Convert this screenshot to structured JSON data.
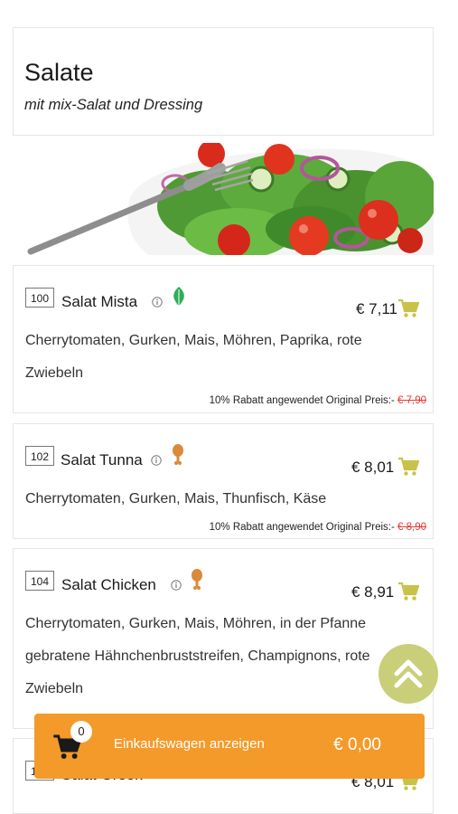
{
  "category": {
    "title": "Salate",
    "subtitle": "mit mix-Salat und Dressing"
  },
  "items": [
    {
      "number": "100",
      "name": "Salat Mista",
      "tag_icon": "leaf-icon",
      "price": "€ 7,11",
      "description": "Cherrytomaten, Gurken, Mais, Möhren, Paprika, rote Zwiebeln",
      "discount_note": "10% Rabatt angewendet Original Preis:- ",
      "original_price": "€ 7,90"
    },
    {
      "number": "102",
      "name": "Salat Tunna",
      "tag_icon": "chicken-leg-icon",
      "price": "€ 8,01",
      "description": "Cherrytomaten, Gurken, Mais, Thunfisch, Käse",
      "discount_note": "10% Rabatt angewendet Original Preis:- ",
      "original_price": "€ 8,90"
    },
    {
      "number": "104",
      "name": "Salat Chicken",
      "tag_icon": "chicken-leg-icon",
      "price": "€ 8,91",
      "description": "Cherrytomaten, Gurken, Mais, Möhren, in der Pfanne gebratene Hähnchenbruststreifen, Champignons, rote Zwiebeln",
      "discount_note": "",
      "original_price": ""
    },
    {
      "number": "106",
      "name": "Salat Greek",
      "tag_icon": "",
      "price": "€ 8,01",
      "description": "",
      "discount_note": "",
      "original_price": ""
    }
  ],
  "cart": {
    "count": "0",
    "label": "Einkaufswagen anzeigen",
    "total": "€ 0,00"
  },
  "colors": {
    "accent_orange": "#f39a2a",
    "cart_icon_olive": "#c9c24a",
    "scroll_button": "#c9cf79",
    "discount_red": "#e53935"
  }
}
